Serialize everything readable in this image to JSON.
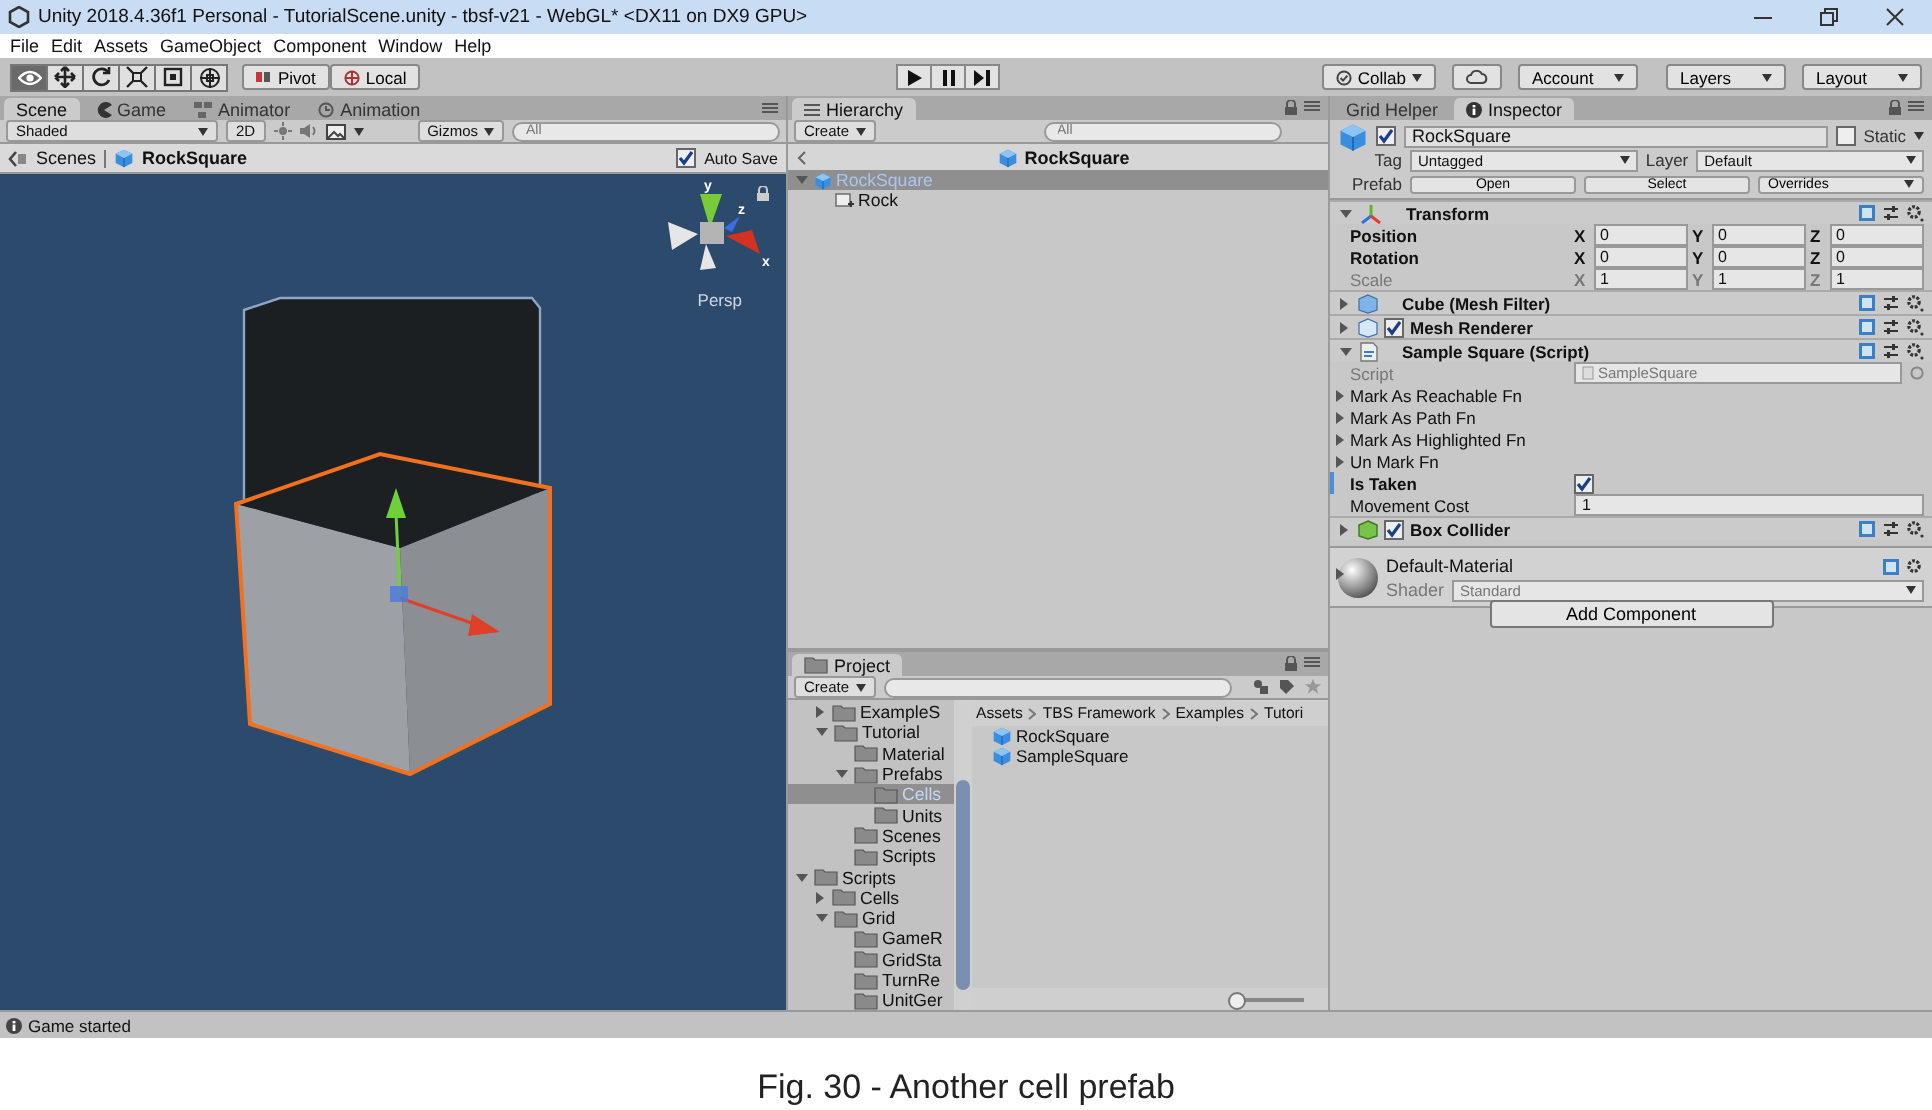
{
  "window": {
    "title": "Unity 2018.4.36f1 Personal - TutorialScene.unity - tbsf-v21 - WebGL* <DX11 on DX9 GPU>"
  },
  "menu": [
    "File",
    "Edit",
    "Assets",
    "GameObject",
    "Component",
    "Window",
    "Help"
  ],
  "toolbar": {
    "tools": [
      {
        "kind": "view",
        "selected": true
      },
      {
        "kind": "move",
        "selected": false
      },
      {
        "kind": "rotate",
        "selected": false
      },
      {
        "kind": "scale",
        "selected": false
      },
      {
        "kind": "rect",
        "selected": false
      },
      {
        "kind": "transform",
        "selected": false
      }
    ],
    "pivot": "Pivot",
    "space": "Local",
    "collab": "Collab",
    "account": "Account",
    "layers": "Layers",
    "layout": "Layout"
  },
  "scene": {
    "tabs": [
      {
        "kind": "scene",
        "label": "Scene",
        "selected": true
      },
      {
        "kind": "game",
        "label": "Game",
        "selected": false
      },
      {
        "kind": "animator",
        "label": "Animator",
        "selected": false
      },
      {
        "kind": "animation",
        "label": "Animation",
        "selected": false
      }
    ],
    "shading": "Shaded",
    "mode_2d": "2D",
    "gizmos": "Gizmos",
    "search_placeholder": "All",
    "breadcrumb": [
      "Scenes",
      "RockSquare"
    ],
    "auto_save": {
      "label": "Auto Save",
      "checked": true
    },
    "axis_labels": [
      "y",
      "z",
      "x"
    ],
    "projection": "Persp"
  },
  "hierarchy": {
    "tab": "Hierarchy",
    "create": "Create",
    "search_placeholder": "All",
    "header": "RockSquare",
    "tree": [
      {
        "label": "RockSquare",
        "kind": "prefab",
        "selected": true,
        "expanded": true,
        "children": [
          {
            "label": "Rock",
            "kind": "object",
            "selected": false
          }
        ]
      }
    ]
  },
  "inspector": {
    "tabs": [
      {
        "label": "Grid Helper",
        "selected": false
      },
      {
        "label": "Inspector",
        "selected": true
      }
    ],
    "object_name": {
      "value": "RockSquare",
      "active": true
    },
    "static": {
      "label": "Static",
      "checked": false
    },
    "tag_label": "Tag",
    "tag": "Untagged",
    "layer_label": "Layer",
    "layer": "Default",
    "prefab_label": "Prefab",
    "prefab_buttons": [
      "Open",
      "Select"
    ],
    "overrides": "Overrides",
    "components": [
      {
        "kind": "transform",
        "title": "Transform",
        "expanded": true,
        "rows": [
          {
            "label": "Position",
            "overridden": true,
            "fields": [
              {
                "axis": "X",
                "value": "0"
              },
              {
                "axis": "Y",
                "value": "0"
              },
              {
                "axis": "Z",
                "value": "0"
              }
            ]
          },
          {
            "label": "Rotation",
            "overridden": true,
            "fields": [
              {
                "axis": "X",
                "value": "0"
              },
              {
                "axis": "Y",
                "value": "0"
              },
              {
                "axis": "Z",
                "value": "0"
              }
            ]
          },
          {
            "label": "Scale",
            "overridden": false,
            "fields": [
              {
                "axis": "X",
                "value": "1"
              },
              {
                "axis": "Y",
                "value": "1"
              },
              {
                "axis": "Z",
                "value": "1"
              }
            ]
          }
        ]
      },
      {
        "kind": "mesh_filter",
        "title": "Cube (Mesh Filter)",
        "expanded": false
      },
      {
        "kind": "renderer",
        "title": "Mesh Renderer",
        "expanded": false,
        "enabled": true
      },
      {
        "kind": "script",
        "title": "Sample Square (Script)",
        "expanded": true,
        "script_label": "Script",
        "script_value": "SampleSquare",
        "events": [
          "Mark As Reachable Fn",
          "Mark As Path Fn",
          "Mark As Highlighted Fn",
          "Un Mark Fn"
        ],
        "is_taken": {
          "label": "Is Taken",
          "checked": true,
          "overridden": true
        },
        "movement_cost": {
          "label": "Movement Cost",
          "value": "1"
        }
      },
      {
        "kind": "collider",
        "title": "Box Collider",
        "expanded": false,
        "enabled": true
      }
    ],
    "material": {
      "name": "Default-Material",
      "shader_label": "Shader",
      "shader": "Standard",
      "expanded": false
    },
    "add_component": "Add Component"
  },
  "project": {
    "tab": "Project",
    "create": "Create",
    "tree": [
      {
        "children": [
          {
            "label": "ExampleS",
            "expanded": false,
            "selected": false
          },
          {
            "label": "Tutorial",
            "expanded": true,
            "selected": false,
            "children": [
              {
                "label": "Material",
                "selected": false
              },
              {
                "label": "Prefabs",
                "expanded": true,
                "selected": false,
                "children": [
                  {
                    "label": "Cells",
                    "selected": true
                  },
                  {
                    "label": "Units",
                    "selected": false
                  }
                ]
              },
              {
                "label": "Scenes",
                "selected": false
              },
              {
                "label": "Scripts",
                "selected": false
              }
            ]
          }
        ]
      },
      {
        "label": "Scripts",
        "expanded": true,
        "selected": false,
        "children": [
          {
            "label": "Cells",
            "expanded": false,
            "selected": false
          },
          {
            "label": "Grid",
            "expanded": true,
            "selected": false,
            "children": [
              {
                "label": "GameR",
                "selected": false
              },
              {
                "label": "GridSta",
                "selected": false
              },
              {
                "label": "TurnRe",
                "selected": false
              },
              {
                "label": "UnitGer",
                "selected": false
              }
            ]
          }
        ]
      }
    ],
    "breadcrumb": [
      "Assets",
      "TBS Framework",
      "Examples",
      "Tutori"
    ],
    "files": [
      "RockSquare",
      "SampleSquare"
    ],
    "zoom": {
      "level": 0.05
    }
  },
  "status_bar": {
    "message": "Game started"
  },
  "caption": "Fig. 30 - Another cell prefab"
}
